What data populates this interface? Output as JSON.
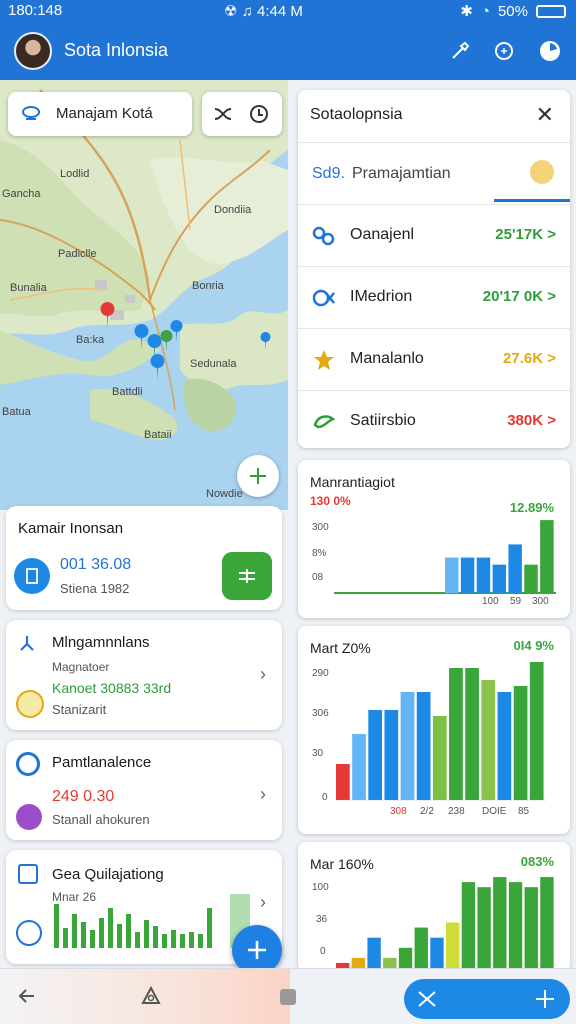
{
  "status": {
    "time": "180:148",
    "center": "☢ ♫ 4:44 M",
    "battery": "50%"
  },
  "app": {
    "title": "Sota Inlonsia"
  },
  "map": {
    "search_label": "Manajam Kotá",
    "labels": [
      "Gancha",
      "Lodlid",
      "Dondiia",
      "Padiclle",
      "Bunalia",
      "Bonria",
      "Ba:ka",
      "Sedunala",
      "Battdli",
      "Batua",
      "Bataii",
      "Nowdie"
    ]
  },
  "cards": [
    {
      "title": "Kamair Inonsan",
      "value": "001 36.08",
      "sub": "Stiena 1982"
    },
    {
      "title": "Mlngamnnlans",
      "sub1": "Magnatoer",
      "value": "Kanoet 30883 33rd",
      "sub2": "Stanizarit"
    },
    {
      "title": "Pamtlanalence",
      "value": "249 0.30",
      "sub": "Stanall ahokuren"
    },
    {
      "title": "Gea Quilajationg",
      "sub": "Mnar 26"
    }
  ],
  "right_panel": {
    "title": "Sotaolopnsia",
    "active_prefix": "Sd9.",
    "active_label": "Pramajamtian",
    "rows": [
      {
        "name": "Oanajenl",
        "value": "25'17K >",
        "color": "#2e9d3a"
      },
      {
        "name": "IMedrion",
        "value": "20'17 0K >",
        "color": "#2e9d3a"
      },
      {
        "name": "Manalanlo",
        "value": "27.6K >",
        "color": "#e5a912"
      },
      {
        "name": "Satiirsbio",
        "value": "380K >",
        "color": "#e53935"
      }
    ]
  },
  "colors": {
    "primary": "#1f74d6",
    "green": "#3aa63a",
    "red": "#e53935",
    "yellow": "#e5a912"
  },
  "chart_data": [
    {
      "type": "bar",
      "title": "Manrantiagiot",
      "red_label": "130 0%",
      "pct": "12.89%",
      "yticks": [
        "300",
        "8%",
        "08"
      ],
      "xticks": [
        "100",
        "59",
        "300"
      ],
      "values": [
        0,
        0,
        0,
        0,
        0,
        0,
        0,
        35,
        35,
        35,
        28,
        48,
        28,
        72
      ]
    },
    {
      "type": "bar",
      "title": "Mart Z0%",
      "pct": "0I4 9%",
      "yticks": [
        "290",
        "306",
        "30",
        "0"
      ],
      "xticks": [
        "308",
        "2/2",
        "238",
        "DOIE",
        "85"
      ],
      "values": [
        30,
        55,
        75,
        75,
        90,
        90,
        70,
        110,
        110,
        100,
        90,
        95,
        115
      ]
    },
    {
      "type": "bar",
      "title": "Mar 160%",
      "pct": "083%",
      "yticks": [
        "100",
        "36",
        "0"
      ],
      "xticks": [],
      "values": [
        5,
        10,
        30,
        10,
        20,
        40,
        30,
        45,
        85,
        80,
        90,
        85,
        80,
        90
      ]
    }
  ]
}
